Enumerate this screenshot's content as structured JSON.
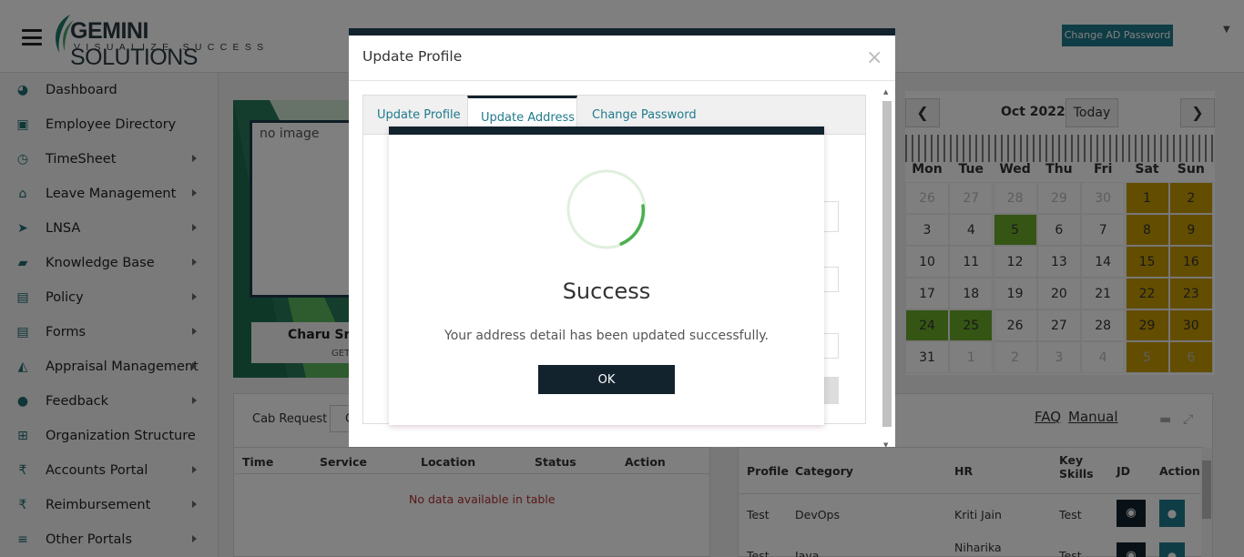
{
  "header": {
    "logo_main": "GEMINI",
    "logo_second": "SOLUTIONS",
    "logo_tagline": "VISUALIZE SUCCESS",
    "change_ad_password": "Change AD Password"
  },
  "sidebar": {
    "items": [
      {
        "label": "Dashboard",
        "icon": "dashboard-icon",
        "has_submenu": false
      },
      {
        "label": "Employee Directory",
        "icon": "directory-icon",
        "has_submenu": false
      },
      {
        "label": "TimeSheet",
        "icon": "clock-icon",
        "has_submenu": true
      },
      {
        "label": "Leave Management",
        "icon": "home-icon",
        "has_submenu": true
      },
      {
        "label": "LNSA",
        "icon": "send-icon",
        "has_submenu": true
      },
      {
        "label": "Knowledge Base",
        "icon": "folder-open-icon",
        "has_submenu": true
      },
      {
        "label": "Policy",
        "icon": "document-icon",
        "has_submenu": true
      },
      {
        "label": "Forms",
        "icon": "form-icon",
        "has_submenu": true
      },
      {
        "label": "Appraisal Management",
        "icon": "graduation-cap-icon",
        "has_submenu": true
      },
      {
        "label": "Feedback",
        "icon": "comments-icon",
        "has_submenu": true
      },
      {
        "label": "Organization Structure",
        "icon": "org-chart-icon",
        "has_submenu": false
      },
      {
        "label": "Accounts Portal",
        "icon": "rupee-icon",
        "has_submenu": true
      },
      {
        "label": "Reimbursement",
        "icon": "rupee-icon",
        "has_submenu": true
      },
      {
        "label": "Other Portals",
        "icon": "list-icon",
        "has_submenu": true
      }
    ]
  },
  "profile_card": {
    "image_alt": "no image",
    "name": "Charu Sriv",
    "subtitle": "GET"
  },
  "cab": {
    "label": "Cab Request",
    "box_text": "C",
    "columns": [
      "Time",
      "Service",
      "Location",
      "Status",
      "Action"
    ],
    "empty": "No data available in table"
  },
  "calendar": {
    "title": "Oct 2022",
    "today": "Today",
    "prev": "❮",
    "next": "❯",
    "dow": [
      "Mon",
      "Tue",
      "Wed",
      "Thu",
      "Fri",
      "Sat",
      "Sun"
    ],
    "weeks": [
      [
        "26",
        "27",
        "28",
        "29",
        "30",
        "1",
        "2"
      ],
      [
        "3",
        "4",
        "5",
        "6",
        "7",
        "8",
        "9"
      ],
      [
        "10",
        "11",
        "12",
        "13",
        "14",
        "15",
        "16"
      ],
      [
        "17",
        "18",
        "19",
        "20",
        "21",
        "22",
        "23"
      ],
      [
        "24",
        "25",
        "26",
        "27",
        "28",
        "29",
        "30"
      ],
      [
        "31",
        "1",
        "2",
        "3",
        "4",
        "5",
        "6"
      ]
    ],
    "colors": {
      "weekend": "#c79a00",
      "highlight": "#6bab2b"
    }
  },
  "jobs": {
    "faq": "FAQ",
    "manual": "Manual",
    "columns": [
      "Profile",
      "Category",
      "HR",
      "Key Skills",
      "JD",
      "Action"
    ],
    "rows": [
      {
        "profile": "Test",
        "category": "DevOps",
        "hr": "Kriti Jain",
        "skills": "Test"
      },
      {
        "profile": "Test",
        "category": "Java",
        "hr": "Niharika",
        "skills": "Test"
      }
    ]
  },
  "modal": {
    "title": "Update Profile",
    "close": "×",
    "tabs": [
      "Update Profile",
      "Update Address",
      "Change Password"
    ],
    "active_tab": 1
  },
  "alert": {
    "title": "Success",
    "message": "Your address detail has been updated successfully.",
    "ok": "OK"
  },
  "colors": {
    "accent": "#1f7a8c",
    "dark": "#13232e",
    "success": "#4caf50"
  }
}
